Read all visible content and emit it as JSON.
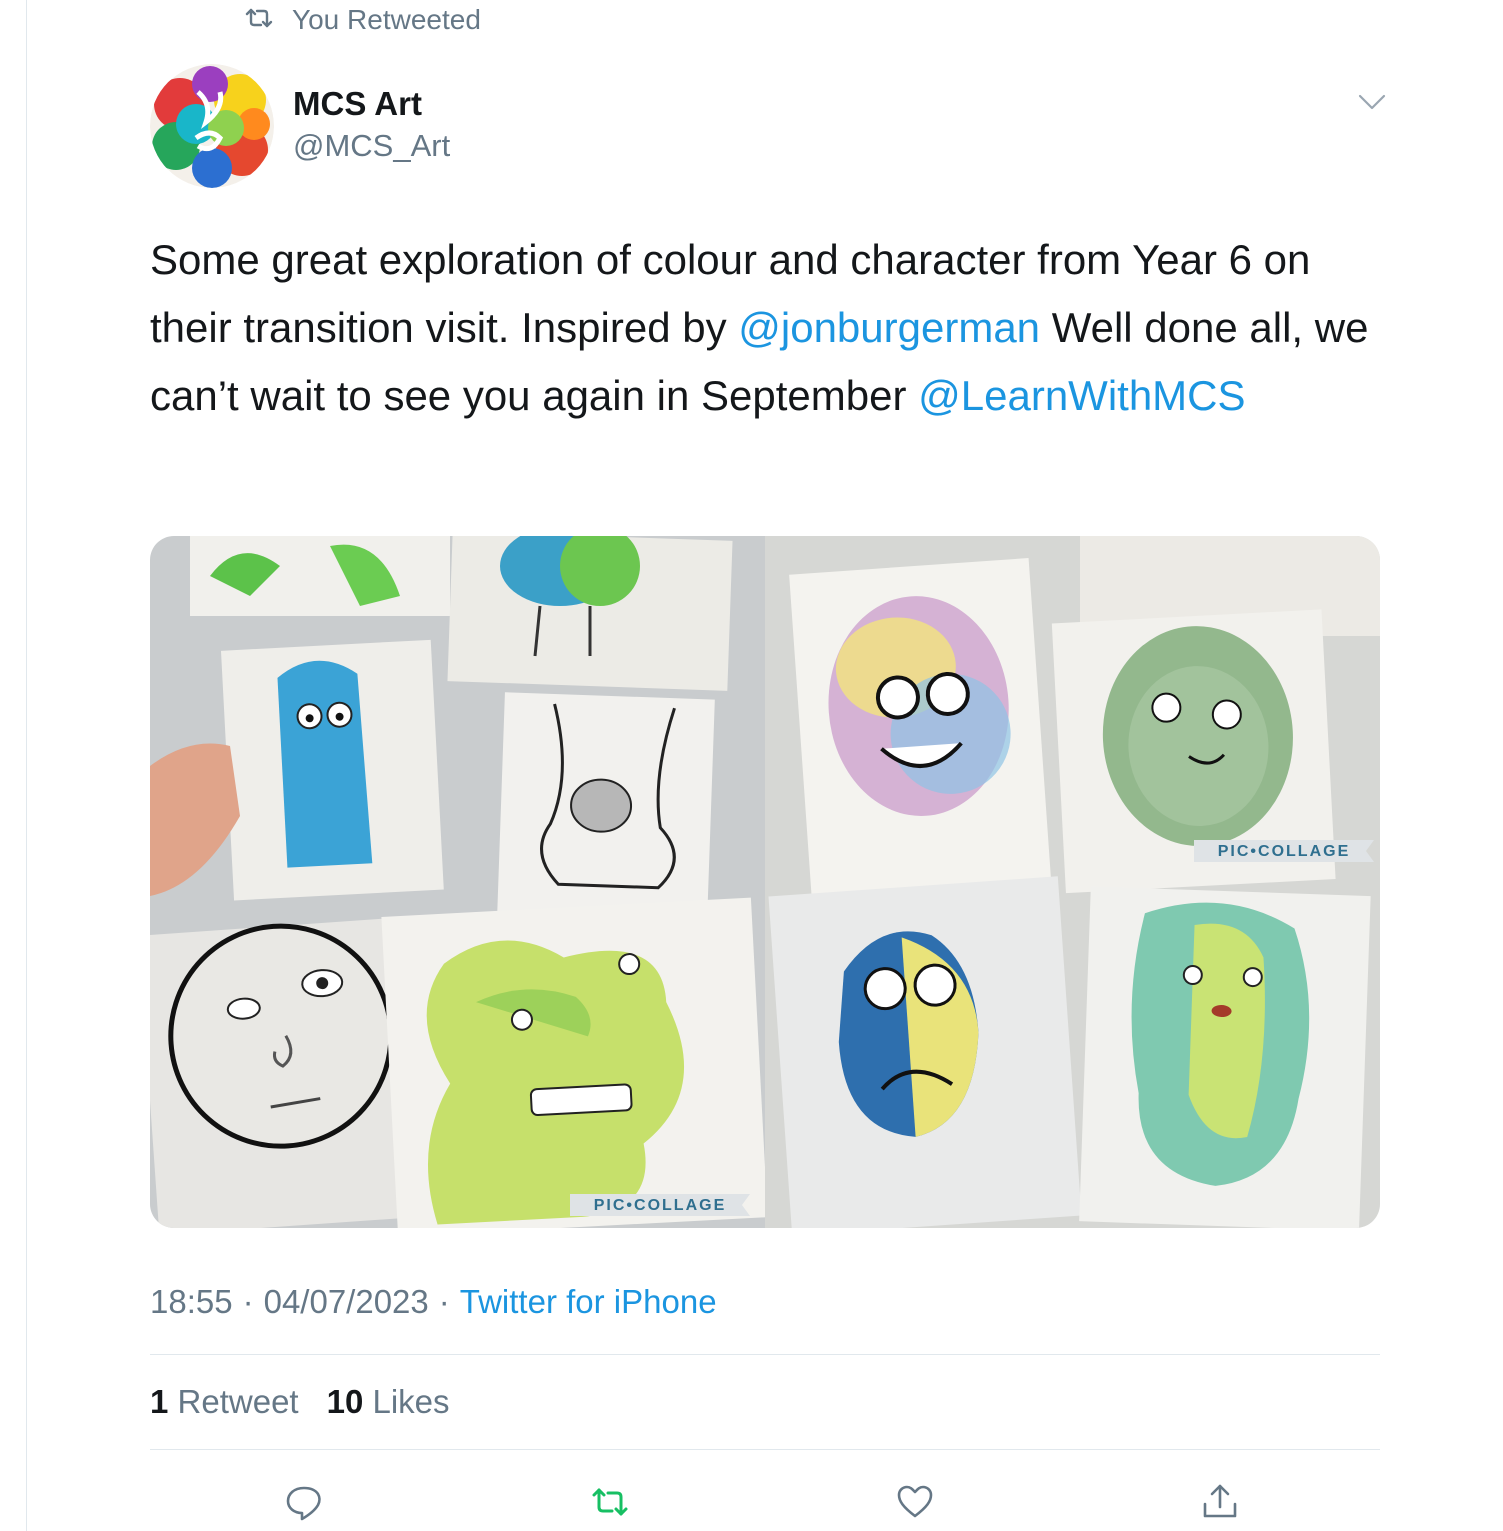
{
  "retweet_banner": {
    "text": "You Retweeted",
    "icon": "retweet-icon"
  },
  "author": {
    "name": "MCS Art",
    "handle": "@MCS_Art",
    "avatar_icon": "avatar-logo"
  },
  "tweet": {
    "text_part1": "Some great exploration of colour and character from Year 6 on their transition visit.  Inspired by ",
    "mention1": "@jonburgerman",
    "text_part2": " Well done all, we can’t wait to see you again in September ",
    "mention2": "@LearnWithMCS"
  },
  "media": {
    "watermark_left": "PIC•COLLAGE",
    "watermark_right": "PIC•COLLAGE"
  },
  "meta": {
    "time": "18:55",
    "sep1": "·",
    "date": "04/07/2023",
    "sep2": "·",
    "source": "Twitter for iPhone"
  },
  "stats": {
    "retweets_count": "1",
    "retweets_label": "Retweet",
    "likes_count": "10",
    "likes_label": "Likes"
  },
  "actions": {
    "reply_icon": "reply-icon",
    "retweet_icon": "retweet-icon",
    "like_icon": "heart-icon",
    "share_icon": "share-icon"
  },
  "colors": {
    "link": "#1b95e0",
    "secondary_text": "#657786",
    "retweet_active": "#17bf63",
    "divider": "#e1e8ed"
  }
}
